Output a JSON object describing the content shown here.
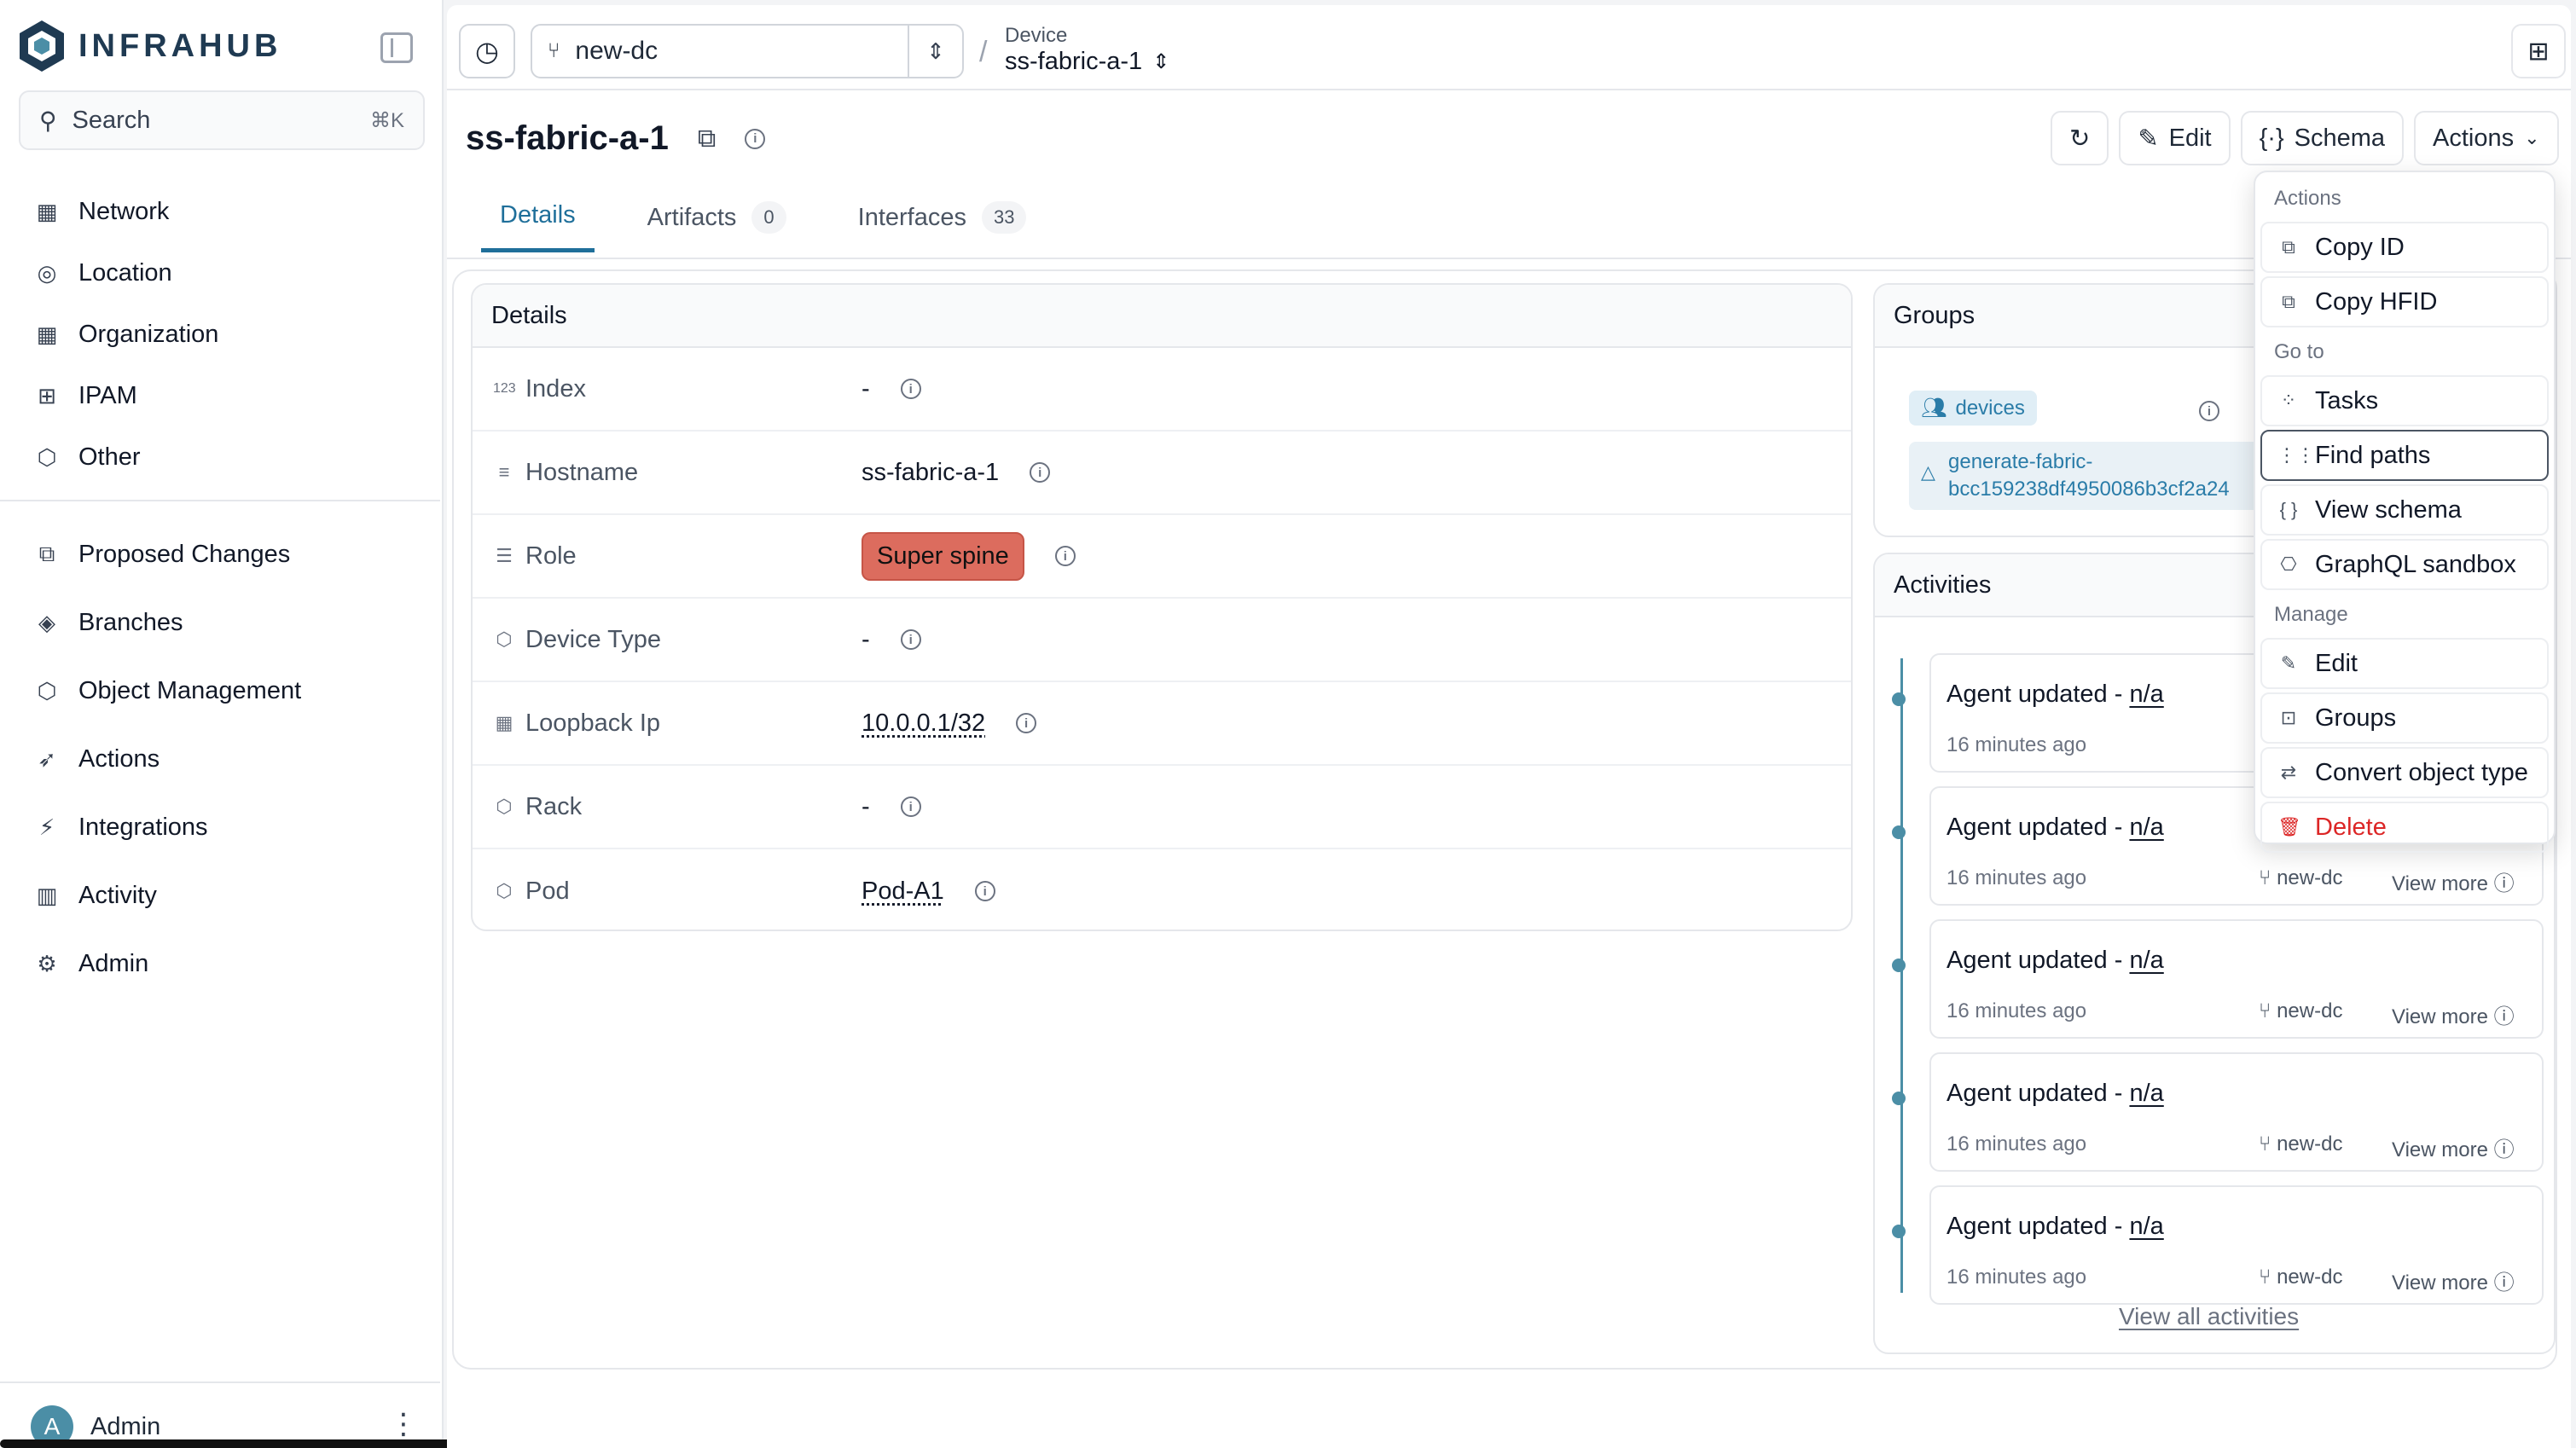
{
  "app": {
    "name": "INFRAHUB"
  },
  "search": {
    "label": "Search",
    "shortcut": "⌘K"
  },
  "sidebar": {
    "primary": [
      {
        "label": "Network",
        "icon": "building-icon"
      },
      {
        "label": "Location",
        "icon": "pin-icon"
      },
      {
        "label": "Organization",
        "icon": "building-icon"
      },
      {
        "label": "IPAM",
        "icon": "ipam-icon"
      },
      {
        "label": "Other",
        "icon": "cube-icon"
      }
    ],
    "secondary": [
      {
        "label": "Proposed Changes",
        "icon": "diff-icon"
      },
      {
        "label": "Branches",
        "icon": "layers-icon"
      },
      {
        "label": "Object Management",
        "icon": "cube-icon"
      },
      {
        "label": "Actions",
        "icon": "rocket-icon"
      },
      {
        "label": "Integrations",
        "icon": "plug-icon"
      },
      {
        "label": "Activity",
        "icon": "chart-icon"
      },
      {
        "label": "Admin",
        "icon": "gear-icon"
      }
    ],
    "user": {
      "initial": "A",
      "name": "Admin"
    }
  },
  "topbar": {
    "branch": "new-dc",
    "breadcrumb_kind": "Device",
    "breadcrumb_name": "ss-fabric-a-1"
  },
  "page": {
    "title": "ss-fabric-a-1",
    "buttons": {
      "edit": "Edit",
      "schema": "Schema",
      "actions": "Actions"
    },
    "tabs": [
      {
        "label": "Details",
        "count": null
      },
      {
        "label": "Artifacts",
        "count": "0"
      },
      {
        "label": "Interfaces",
        "count": "33"
      }
    ]
  },
  "details": {
    "header": "Details",
    "rows": [
      {
        "icon": "number-icon",
        "glyph": "123",
        "label": "Index",
        "value": "-"
      },
      {
        "icon": "text-icon",
        "glyph": "≡",
        "label": "Hostname",
        "value": "ss-fabric-a-1"
      },
      {
        "icon": "list-icon",
        "glyph": "☰",
        "label": "Role",
        "value": "Super spine"
      },
      {
        "icon": "cube-icon",
        "glyph": "⬡",
        "label": "Device Type",
        "value": "-"
      },
      {
        "icon": "ip-icon",
        "glyph": "▦",
        "label": "Loopback Ip",
        "value": "10.0.0.1/32"
      },
      {
        "icon": "cube-icon",
        "glyph": "⬡",
        "label": "Rack",
        "value": "-"
      },
      {
        "icon": "cube-icon",
        "glyph": "⬡",
        "label": "Pod",
        "value": "Pod-A1"
      }
    ]
  },
  "groups": {
    "header": "Groups",
    "items": [
      "devices",
      "generate-fabric-bcc159238df4950086b3cf2a24"
    ]
  },
  "activities": {
    "header": "Activities",
    "items": [
      {
        "title": "Agent updated - ",
        "who": "n/a",
        "time": "16 minutes ago",
        "branch": "",
        "more": ""
      },
      {
        "title": "Agent updated - ",
        "who": "n/a",
        "time": "16 minutes ago",
        "branch": "new-dc",
        "more": "View more"
      },
      {
        "title": "Agent updated - ",
        "who": "n/a",
        "time": "16 minutes ago",
        "branch": "new-dc",
        "more": "View more"
      },
      {
        "title": "Agent updated - ",
        "who": "n/a",
        "time": "16 minutes ago",
        "branch": "new-dc",
        "more": "View more"
      },
      {
        "title": "Agent updated - ",
        "who": "n/a",
        "time": "16 minutes ago",
        "branch": "new-dc",
        "more": "View more"
      }
    ],
    "view_all": "View all activities"
  },
  "actions_menu": {
    "sections": {
      "actions": "Actions",
      "goto": "Go to",
      "manage": "Manage"
    },
    "items": {
      "copy_id": "Copy ID",
      "copy_hfid": "Copy HFID",
      "tasks": "Tasks",
      "find_paths": "Find paths",
      "view_schema": "View schema",
      "graphql": "GraphQL sandbox",
      "edit": "Edit",
      "groups": "Groups",
      "convert": "Convert object type",
      "delete": "Delete"
    }
  },
  "colors": {
    "accent": "#1f6f9a",
    "role_badge": "#dc6c5e",
    "danger": "#dc2626",
    "timeline": "#4b8ea6"
  }
}
